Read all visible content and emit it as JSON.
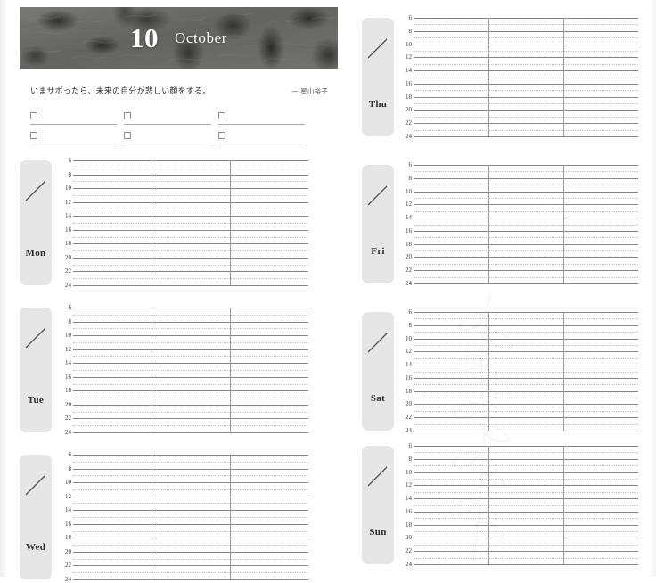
{
  "header": {
    "day_number": "10",
    "month_name": "October",
    "banner_icon": "botanical-leaves-photo"
  },
  "quote": {
    "text": "いまサボったら、未来の自分が悲しい顔をする。",
    "dash": "—",
    "author": "星山裕子"
  },
  "todo": {
    "items": [
      {
        "checked": false,
        "value": ""
      },
      {
        "checked": false,
        "value": ""
      },
      {
        "checked": false,
        "value": ""
      },
      {
        "checked": false,
        "value": ""
      },
      {
        "checked": false,
        "value": ""
      },
      {
        "checked": false,
        "value": ""
      }
    ]
  },
  "time_grid": {
    "hour_labels": [
      "6",
      "8",
      "10",
      "12",
      "14",
      "16",
      "18",
      "20",
      "22",
      "24"
    ],
    "column_dividers": 2,
    "date_slash_icon": "diagonal-slash-date-line"
  },
  "days": {
    "left_page": [
      {
        "name": "Mon",
        "date_value": ""
      },
      {
        "name": "Tue",
        "date_value": ""
      },
      {
        "name": "Wed",
        "date_value": ""
      }
    ],
    "right_page": [
      {
        "name": "Thu",
        "date_value": ""
      },
      {
        "name": "Fri",
        "date_value": ""
      },
      {
        "name": "Sat",
        "date_value": ""
      },
      {
        "name": "Sun",
        "date_value": ""
      }
    ]
  },
  "colors": {
    "banner_bg": "#6a6a68",
    "tab_bg": "#e6e6e6",
    "solid_line": "#858585",
    "dotted_line": "#c3c3c3",
    "divider_line": "#9a9a9a",
    "page_bg": "#ffffff"
  }
}
